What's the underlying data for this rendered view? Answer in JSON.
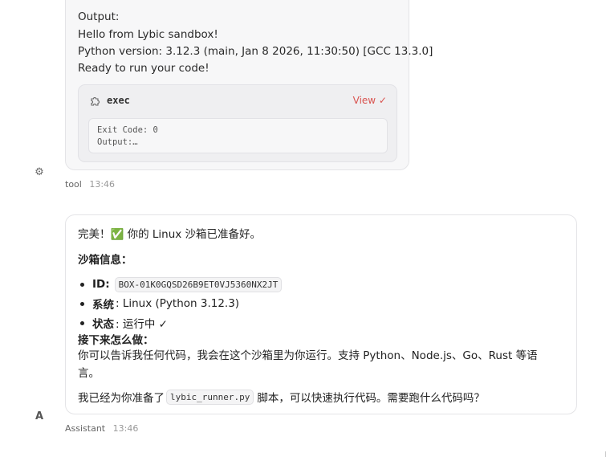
{
  "tool_message": {
    "output_label": "Output:",
    "lines": [
      "Hello from Lybic sandbox!",
      "Python version: 3.12.3 (main, Jan 8 2026, 11:30:50) [GCC 13.3.0]",
      "Ready to run your code!"
    ],
    "exec": {
      "title": "exec",
      "view_label": "View ✓",
      "output_lines": [
        "Exit Code: 0",
        "Output:…"
      ]
    },
    "sender": "tool",
    "time": "13:46",
    "avatar_icon": "gear-icon"
  },
  "assistant_message": {
    "intro": "完美！✅ 你的 Linux 沙箱已准备好。",
    "info_heading": "沙箱信息：",
    "info_items": [
      {
        "label": "ID:",
        "code": "BOX-01K0GQSD26B9ET0VJ5360NX2JT",
        "value": ""
      },
      {
        "label": "系统",
        "code": "",
        "value": ": Linux (Python 3.12.3)"
      },
      {
        "label": "状态",
        "code": "",
        "value": ": 运行中 ✓"
      }
    ],
    "next_heading": "接下来怎么做：",
    "next_text": "你可以告诉我任何代码，我会在这个沙箱里为你运行。支持 Python、Node.js、Go、Rust 等语言。",
    "last_before": "我已经为你准备了",
    "last_code": "lybic_runner.py",
    "last_after": "脚本，可以快速执行代码。需要跑什么代码吗？",
    "sender": "Assistant",
    "time": "13:46",
    "avatar_letter": "A"
  }
}
